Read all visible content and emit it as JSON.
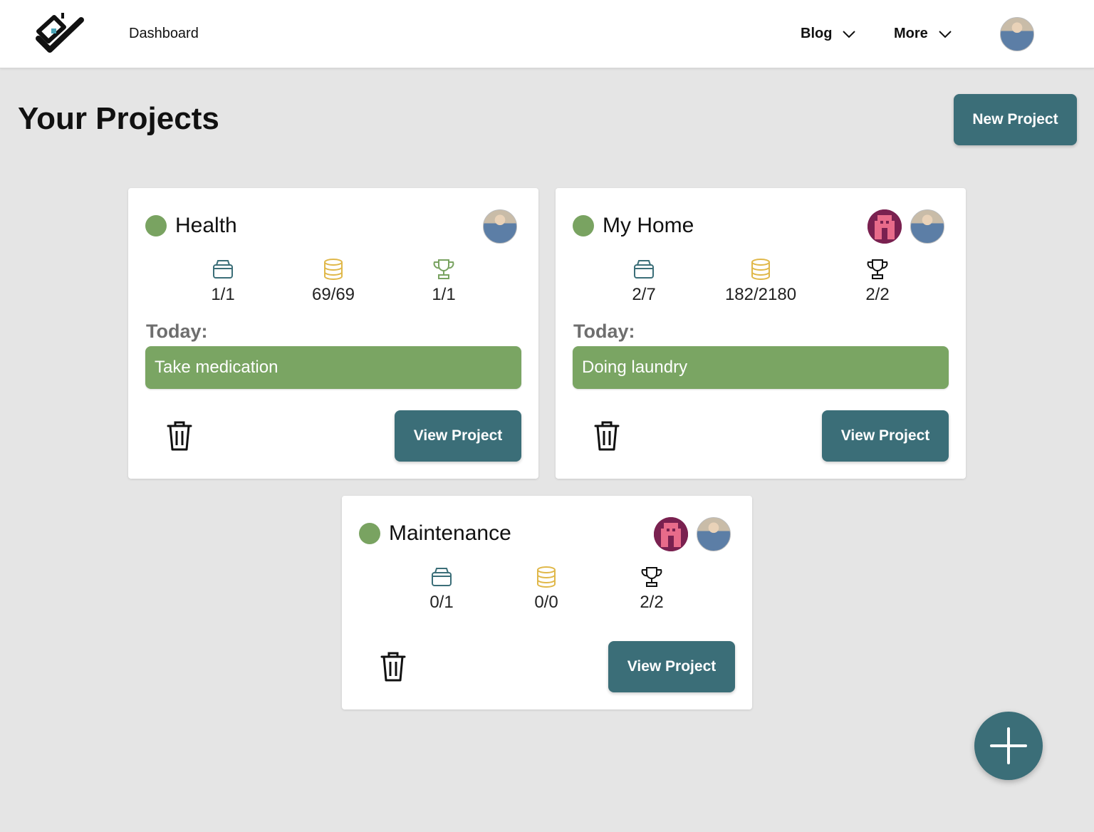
{
  "header": {
    "nav_dashboard": "Dashboard",
    "nav_blog": "Blog",
    "nav_more": "More"
  },
  "page": {
    "title": "Your Projects",
    "new_project_label": "New Project"
  },
  "colors": {
    "primary": "#3b6e78",
    "status_green": "#79a361",
    "task_green": "#7aa563",
    "coins_gold": "#e0b84a",
    "trophy_green": "#79a361"
  },
  "projects": [
    {
      "name": "Health",
      "stats": {
        "tasks": "1/1",
        "coins": "69/69",
        "trophies": "1/1"
      },
      "today_label": "Today:",
      "today_task": "Take medication",
      "view_label": "View Project"
    },
    {
      "name": "My Home",
      "stats": {
        "tasks": "2/7",
        "coins": "182/2180",
        "trophies": "2/2"
      },
      "today_label": "Today:",
      "today_task": "Doing laundry",
      "view_label": "View Project"
    },
    {
      "name": "Maintenance",
      "stats": {
        "tasks": "0/1",
        "coins": "0/0",
        "trophies": "2/2"
      },
      "view_label": "View Project"
    }
  ]
}
